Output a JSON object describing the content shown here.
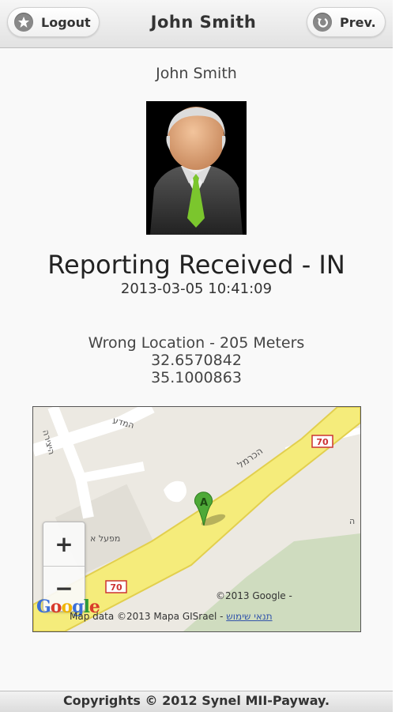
{
  "header": {
    "logout_label": "Logout",
    "title": "John Smith",
    "prev_label": "Prev."
  },
  "profile": {
    "name": "John Smith"
  },
  "report": {
    "status": "Reporting Received - IN",
    "timestamp": "2013-03-05 10:41:09"
  },
  "location": {
    "warning": "Wrong Location - 205 Meters",
    "latitude": "32.6570842",
    "longitude": "35.1000863"
  },
  "map": {
    "marker_label": "A",
    "route_badge_1": "70",
    "route_badge_2": "70",
    "street_labels": [
      "המדע",
      "הכרמל",
      "היצירה",
      "מפעל א",
      "ה"
    ],
    "copyright": "©2013 Google -",
    "map_data": "Map data ©2013 Mapa GISrael -",
    "terms": "תנאי שימוש",
    "logo": "Google",
    "zoom_in": "+",
    "zoom_out": "−"
  },
  "footer": {
    "copyright": "Copyrights © 2012 Synel MII-Payway."
  }
}
